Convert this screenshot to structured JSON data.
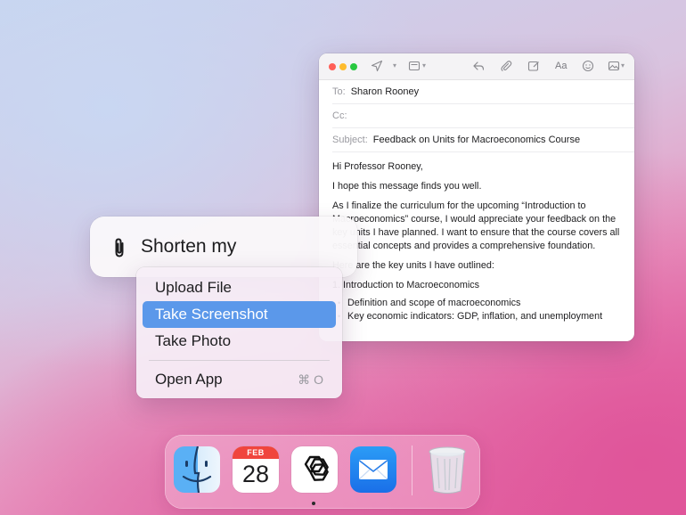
{
  "mail": {
    "to_label": "To:",
    "to_value": "Sharon Rooney",
    "cc_label": "Cc:",
    "cc_value": "",
    "subject_label": "Subject:",
    "subject_value": "Feedback on Units for Macroeconomics Course",
    "toolbar": {
      "icons": [
        "send-icon",
        "chevron-down-icon",
        "format-icon",
        "reply-icon",
        "attachment-icon",
        "compose-icon",
        "font-icon",
        "emoji-icon",
        "photo-icon"
      ],
      "font_label": "Aa"
    },
    "body": {
      "greeting": "Hi Professor Rooney,",
      "p1": "I hope this message finds you well.",
      "p2": "As I finalize the curriculum for the upcoming “Introduction to Macroeconomics” course, I would appreciate your feedback on the key units I have planned. I want to ensure that the course covers all essential concepts and provides a comprehensive foundation.",
      "p3": "Here are the key units I have outlined:",
      "unit1": "1. Introduction to Macroeconomics",
      "bullets": [
        "Definition and scope of macroeconomics",
        "Key economic indicators: GDP, inflation, and unemployment"
      ]
    }
  },
  "prompt": {
    "text": "Shorten my",
    "icon": "paperclip-icon"
  },
  "menu": {
    "items": [
      {
        "label": "Upload File",
        "selected": false
      },
      {
        "label": "Take Screenshot",
        "selected": true
      },
      {
        "label": "Take Photo",
        "selected": false
      }
    ],
    "open_app": {
      "label": "Open App",
      "shortcut": "⌘ O"
    }
  },
  "dock": {
    "apps": [
      "finder-icon",
      "calendar-icon",
      "chatgpt-icon",
      "mail-icon",
      "trash-icon"
    ],
    "calendar_month": "FEB",
    "calendar_day": "28"
  }
}
